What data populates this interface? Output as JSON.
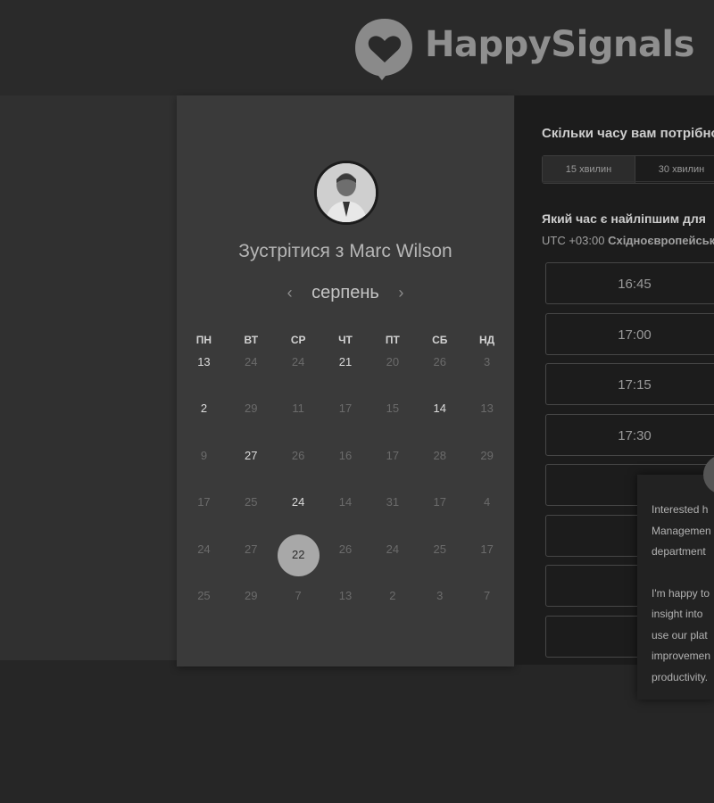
{
  "brand": {
    "name": "HappySignals"
  },
  "host": {
    "avatar_icon": "person-avatar",
    "meet_title": "Зустрітися з Marc Wilson"
  },
  "calendar": {
    "month": "серпень",
    "prev_arrow": "‹",
    "next_arrow": "›",
    "weekdays": [
      "ПН",
      "ВТ",
      "СР",
      "ЧТ",
      "ПТ",
      "СБ",
      "НД"
    ],
    "weeks": [
      [
        "13",
        "24",
        "24",
        "21",
        "20",
        "26",
        "3"
      ],
      [
        "2",
        "29",
        "11",
        "17",
        "15",
        "14",
        "13"
      ],
      [
        "9",
        "27",
        "26",
        "16",
        "17",
        "28",
        "29"
      ],
      [
        "17",
        "25",
        "24",
        "14",
        "31",
        "17",
        "4"
      ],
      [
        "24",
        "27",
        "22",
        "26",
        "24",
        "25",
        "17"
      ],
      [
        "25",
        "29",
        "7",
        "13",
        "2",
        "3",
        "7"
      ]
    ],
    "available": [
      [
        0,
        0
      ],
      [
        0,
        3
      ],
      [
        1,
        0
      ],
      [
        1,
        5
      ],
      [
        2,
        1
      ],
      [
        3,
        2
      ]
    ],
    "selected": [
      4,
      2
    ]
  },
  "booking": {
    "duration_question": "Скільки часу вам потрібно",
    "durations": [
      "15 хвилин",
      "30 хвилин"
    ],
    "time_question": "Який час є найліпшим для",
    "timezone_offset": "UTC +03:00",
    "timezone_name": "Східноєвропейськ",
    "slots": [
      "16:45",
      "17:00",
      "17:15",
      "17:30",
      "",
      "",
      "",
      ""
    ]
  },
  "chat": {
    "p1": [
      "Interested h",
      "Managemen",
      "department"
    ],
    "p2": [
      "I'm happy to",
      "insight into",
      "use our plat",
      "improvemen",
      "productivity."
    ]
  },
  "colors": {
    "selected_day": "#a8a8a8",
    "calendar_panel": "#3a3a3a",
    "right_panel": "#1c1c1c"
  }
}
